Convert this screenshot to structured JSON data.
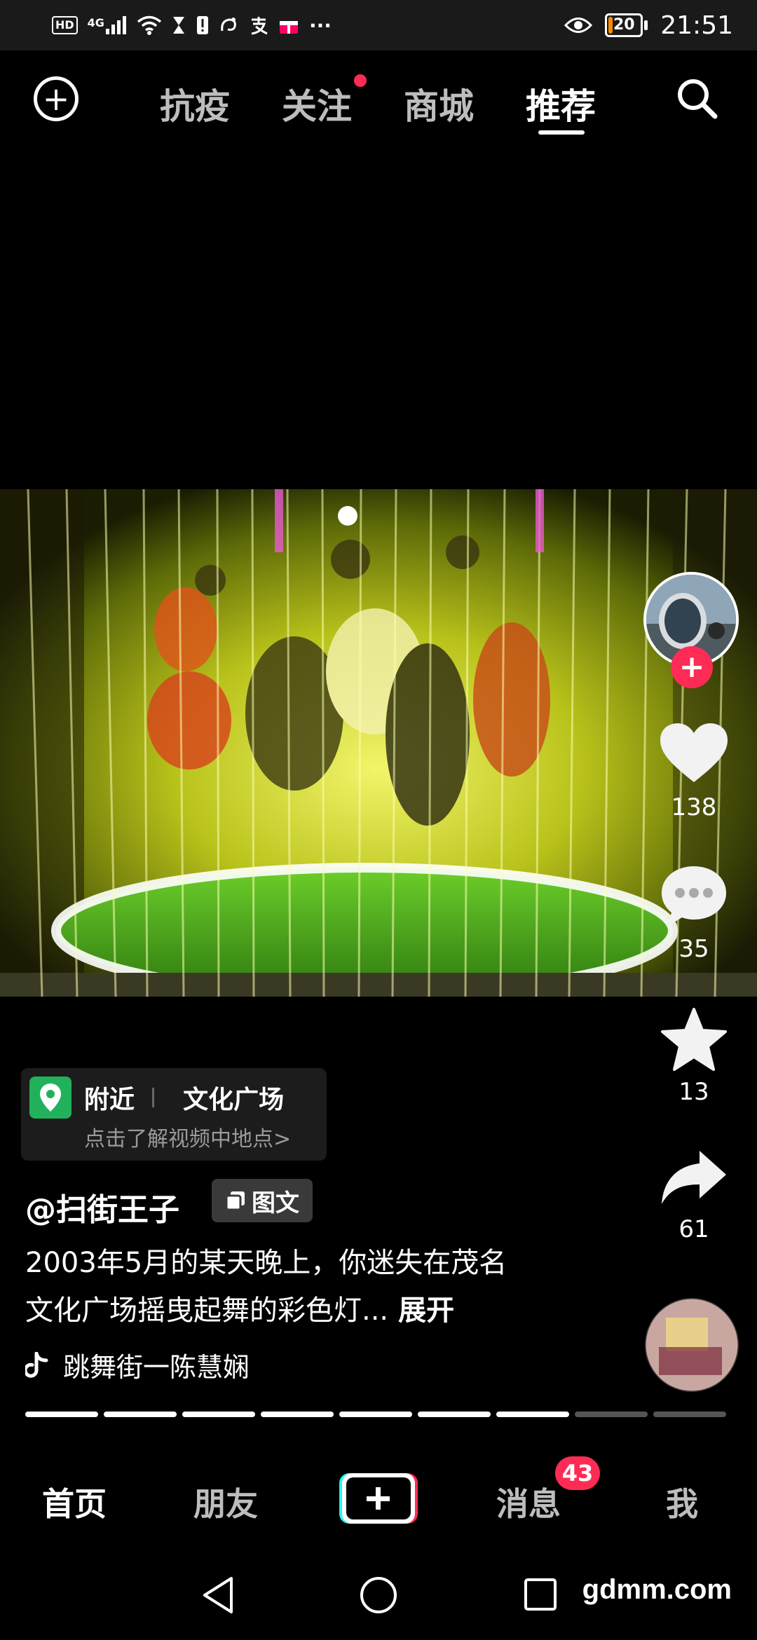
{
  "status_bar": {
    "hd_label": "HD",
    "network_label": "4G",
    "battery_level": "20",
    "time": "21:51",
    "icons": [
      "hd-icon",
      "signal-icon",
      "wifi-icon",
      "hourglass-icon",
      "alert-icon",
      "app-icon",
      "alipay-icon",
      "gift-icon",
      "more-icon",
      "eye-icon",
      "battery-icon"
    ]
  },
  "top_nav": {
    "tabs": [
      {
        "label": "抗疫"
      },
      {
        "label": "关注"
      },
      {
        "label": "商城"
      },
      {
        "label": "推荐"
      }
    ],
    "active_tab": "推荐"
  },
  "right_rail": {
    "likes": "138",
    "comments": "35",
    "favorites": "13",
    "shares": "61"
  },
  "location": {
    "nearby": "附近",
    "place": "文化广场",
    "subtitle": "点击了解视频中地点>"
  },
  "post": {
    "author": "@扫街王子",
    "type_tag": "图文",
    "description": "2003年5月的某天晚上，你迷失在茂名文化广场摇曳起舞的彩色灯...",
    "expand_label": "展开",
    "music": "跳舞街一陈慧娴"
  },
  "progress": {
    "total": 9,
    "viewed": 7
  },
  "bottom_nav": {
    "home": "首页",
    "friends": "朋友",
    "messages": "消息",
    "messages_badge": "43",
    "me": "我"
  },
  "watermark": "gdmm.com",
  "colors": {
    "accent": "#fe2c55",
    "location_green": "#21b15b",
    "background": "#000000"
  }
}
